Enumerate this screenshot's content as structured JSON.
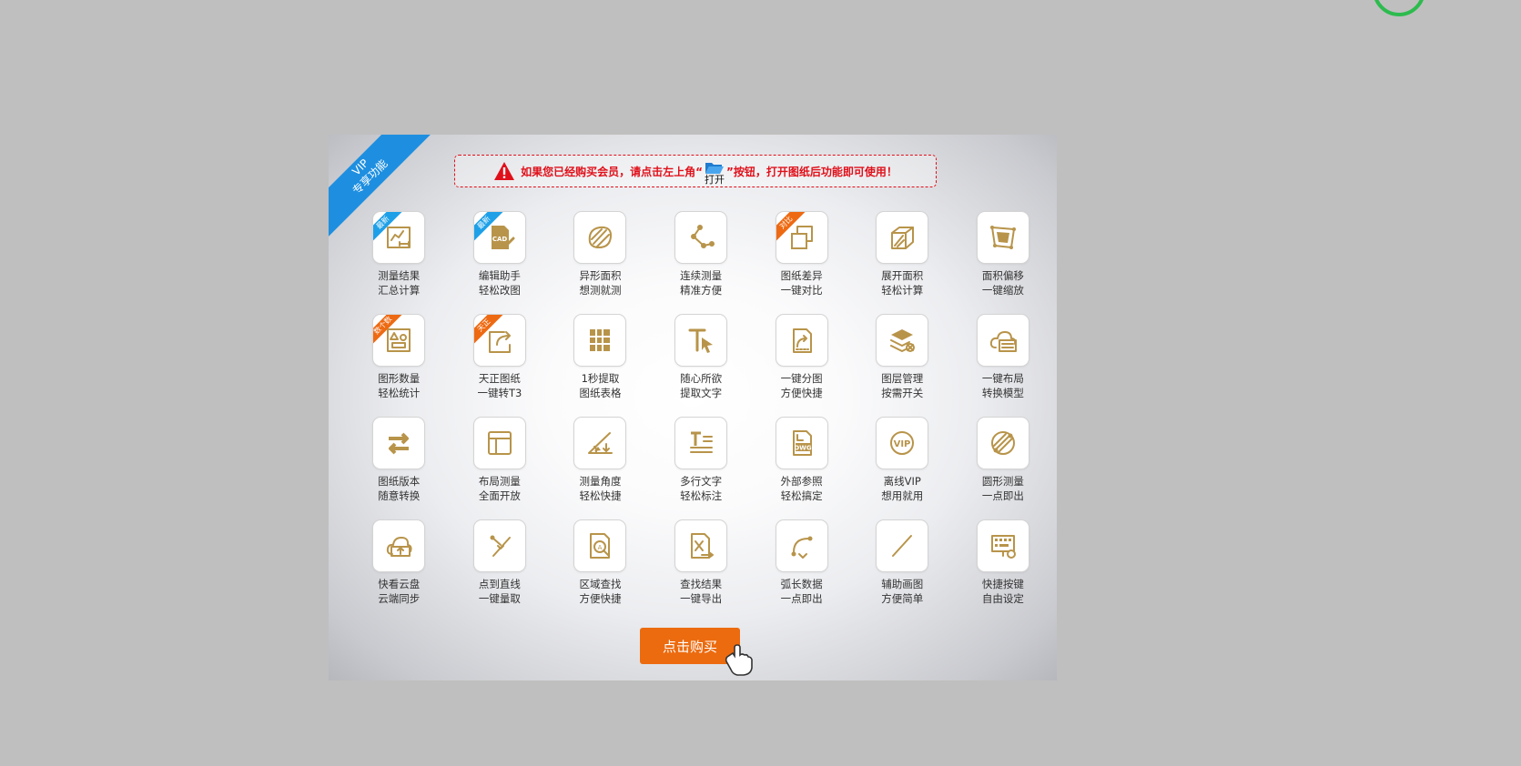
{
  "notice": {
    "text_before": "如果您已经购买会员，请点击左上角“",
    "open_label": "打开",
    "text_after": "”按钮，打开图纸后功能即可使用！"
  },
  "ribbon": {
    "line1": "VIP",
    "line2": "专享功能"
  },
  "features": [
    {
      "name": "测量结果",
      "sub": "汇总计算",
      "tag": "最新",
      "tag_color": "blue"
    },
    {
      "name": "编辑助手",
      "sub": "轻松改图",
      "tag": "最新",
      "tag_color": "blue"
    },
    {
      "name": "异形面积",
      "sub": "想测就测"
    },
    {
      "name": "连续测量",
      "sub": "精准方便"
    },
    {
      "name": "图纸差异",
      "sub": "一键对比",
      "tag": "对比",
      "tag_color": "orange"
    },
    {
      "name": "展开面积",
      "sub": "轻松计算"
    },
    {
      "name": "面积偏移",
      "sub": "一键缩放"
    },
    {
      "name": "图形数量",
      "sub": "轻松统计",
      "tag": "数个数",
      "tag_color": "orange"
    },
    {
      "name": "天正图纸",
      "sub": "一键转T3",
      "tag": "天正",
      "tag_color": "orange"
    },
    {
      "name": "1秒提取",
      "sub": "图纸表格"
    },
    {
      "name": "随心所欲",
      "sub": "提取文字"
    },
    {
      "name": "一键分图",
      "sub": "方便快捷"
    },
    {
      "name": "图层管理",
      "sub": "按需开关"
    },
    {
      "name": "一键布局",
      "sub": "转换模型"
    },
    {
      "name": "图纸版本",
      "sub": "随意转换"
    },
    {
      "name": "布局测量",
      "sub": "全面开放"
    },
    {
      "name": "测量角度",
      "sub": "轻松快捷"
    },
    {
      "name": "多行文字",
      "sub": "轻松标注"
    },
    {
      "name": "外部参照",
      "sub": "轻松搞定"
    },
    {
      "name": "离线VIP",
      "sub": "想用就用"
    },
    {
      "name": "圆形测量",
      "sub": "一点即出"
    },
    {
      "name": "快看云盘",
      "sub": "云端同步"
    },
    {
      "name": "点到直线",
      "sub": "一键量取"
    },
    {
      "name": "区域查找",
      "sub": "方便快捷"
    },
    {
      "name": "查找结果",
      "sub": "一键导出"
    },
    {
      "name": "弧长数据",
      "sub": "一点即出"
    },
    {
      "name": "辅助画图",
      "sub": "方便简单"
    },
    {
      "name": "快捷按键",
      "sub": "自由设定"
    }
  ],
  "icons": [
    "summary-chart-icon",
    "cad-edit-icon",
    "irregular-area-icon",
    "continuous-measure-icon",
    "compare-icon",
    "unfold-area-icon",
    "area-offset-icon",
    "shape-count-icon",
    "tangent-export-icon",
    "table-extract-icon",
    "text-extract-icon",
    "split-drawing-icon",
    "layer-manage-icon",
    "layout-cloud-icon",
    "version-convert-icon",
    "layout-measure-icon",
    "angle-measure-icon",
    "multiline-text-icon",
    "xref-dwg-icon",
    "offline-vip-icon",
    "circle-measure-icon",
    "cloud-sync-icon",
    "point-line-icon",
    "region-search-icon",
    "export-result-icon",
    "arc-length-icon",
    "draw-line-icon",
    "shortcut-keys-icon"
  ],
  "buy_button": "点击购买",
  "colors": {
    "accent": "#ec6b0f",
    "icon": "#b8944a",
    "ribbon": "#1e8fe0",
    "warning": "#e0101a"
  }
}
